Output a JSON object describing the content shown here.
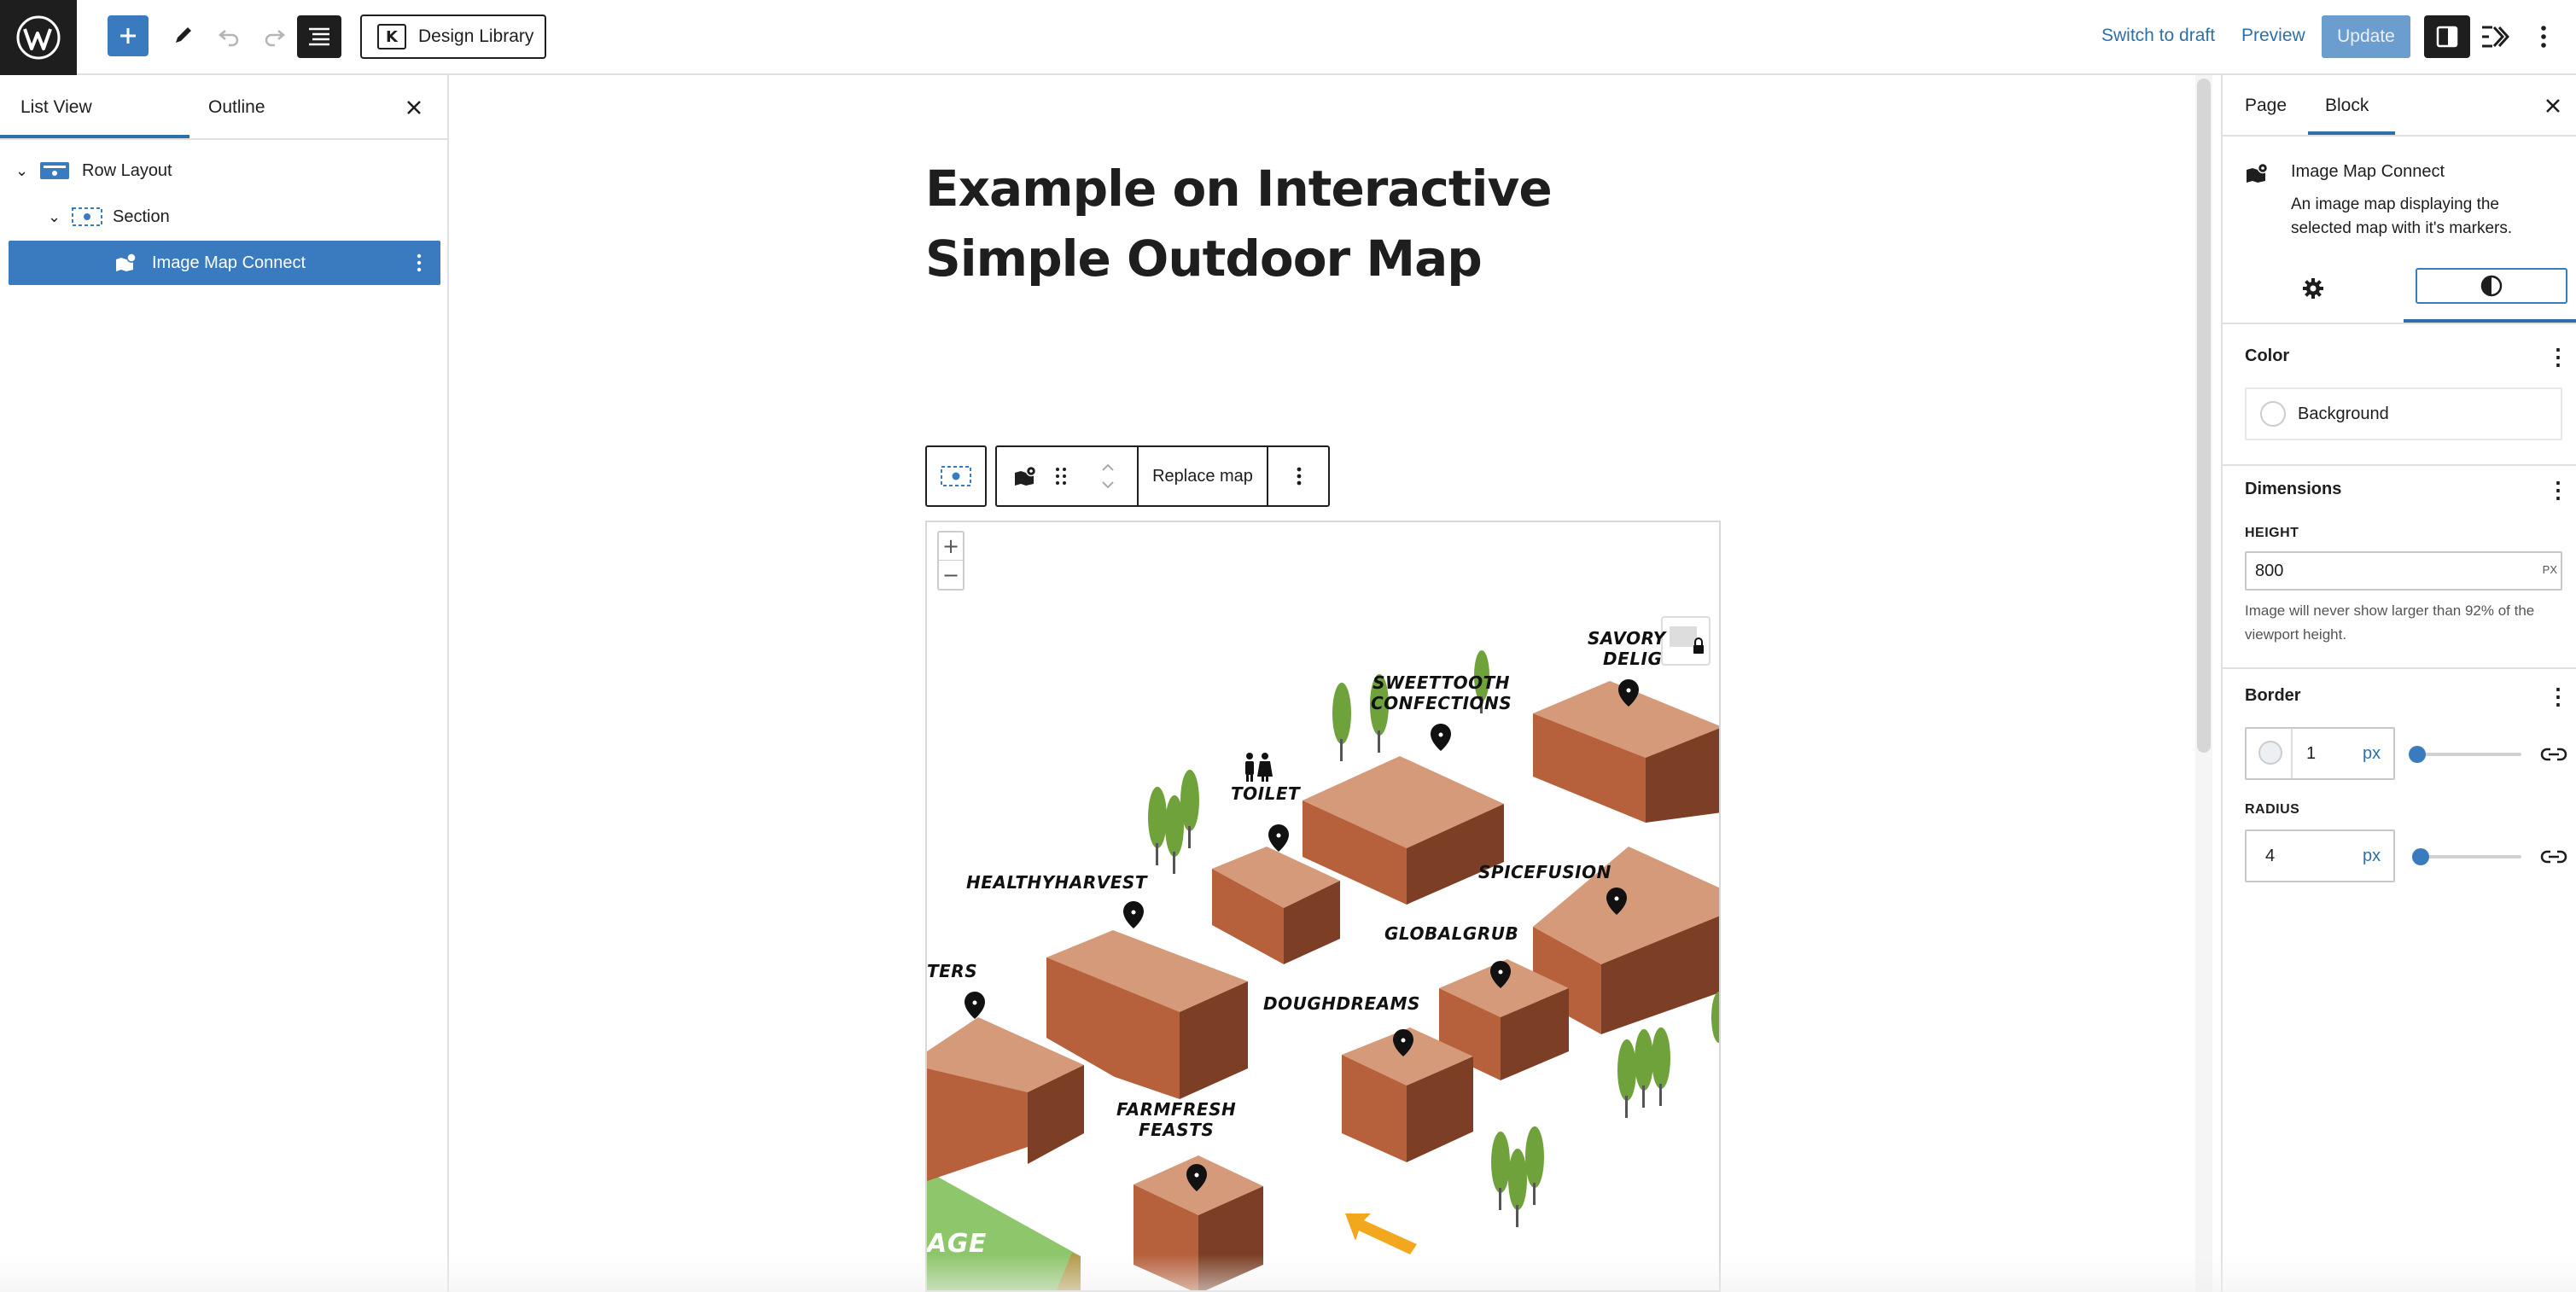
{
  "topbar": {
    "design_library_label": "Design Library",
    "design_library_icon_letter": "K",
    "switch_to_draft_label": "Switch to draft",
    "preview_label": "Preview",
    "update_label": "Update",
    "icons": [
      "wordpress-logo-icon",
      "plus-icon",
      "pencil-icon",
      "undo-icon",
      "redo-icon",
      "list-view-icon",
      "settings-panel-icon",
      "kadence-icon",
      "more-vertical-icon"
    ]
  },
  "left_panel": {
    "tabs": [
      {
        "label": "List View",
        "active": true
      },
      {
        "label": "Outline",
        "active": false
      }
    ],
    "tree": [
      {
        "label": "Row Layout",
        "level": 1,
        "expanded": true
      },
      {
        "label": "Section",
        "level": 2,
        "expanded": true
      },
      {
        "label": "Image Map Connect",
        "level": 3,
        "selected": true
      }
    ]
  },
  "canvas": {
    "title": "Example on Interactive Simple Outdoor Map",
    "block_toolbar": {
      "replace_label": "Replace map"
    },
    "map": {
      "zoom_in": "+",
      "zoom_out": "−",
      "labels": [
        "SAVORY DELIGHTS",
        "SWEETTOOTH CONFECTIONS",
        "TOILET",
        "HEALTHYHARVEST",
        "SPICEFUSION",
        "GLOBALGRUB",
        "DOUGHDREAMS",
        "FARMFRESH FEASTS",
        "TERS",
        "AGE"
      ],
      "label_lines": {
        "savory_1": "SAVORY",
        "savory_2": "DELIG",
        "sweettooth_1": "SWEETTOOTH",
        "sweettooth_2": "CONFECTIONS",
        "toilet": "TOILET",
        "healthyharvest": "HEALTHYHARVEST",
        "spicefusion": "SPICEFUSION",
        "globalgrub": "GLOBALGRUB",
        "doughdreams": "DOUGHDREAMS",
        "farmfresh_1": "FARMFRESH",
        "farmfresh_2": "FEASTS",
        "ters": "TERS",
        "age": "AGE"
      },
      "colors": {
        "roof": "#d49a7a",
        "wall_light": "#b6603c",
        "wall_dark": "#7c3f26",
        "tree": "#6fa23a",
        "grass": "#8dc66b",
        "arrow": "#f2a71f"
      }
    }
  },
  "right_panel": {
    "tabs": [
      {
        "label": "Page",
        "active": false
      },
      {
        "label": "Block",
        "active": true
      }
    ],
    "block_card": {
      "title": "Image Map Connect",
      "description": "An image map displaying the selected map with it's markers."
    },
    "color": {
      "heading": "Color",
      "background_label": "Background"
    },
    "dimensions": {
      "heading": "Dimensions",
      "height_label": "HEIGHT",
      "height_value": "800",
      "height_unit": "PX",
      "help": "Image will never show larger than 92% of the viewport height."
    },
    "border": {
      "heading": "Border",
      "width_value": "1",
      "width_unit": "px",
      "radius_label": "RADIUS",
      "radius_value": "4",
      "radius_unit": "px",
      "width_slider_fraction": 0.0,
      "radius_slider_fraction": 0.02
    },
    "accent_color": "#3a7bbf"
  }
}
